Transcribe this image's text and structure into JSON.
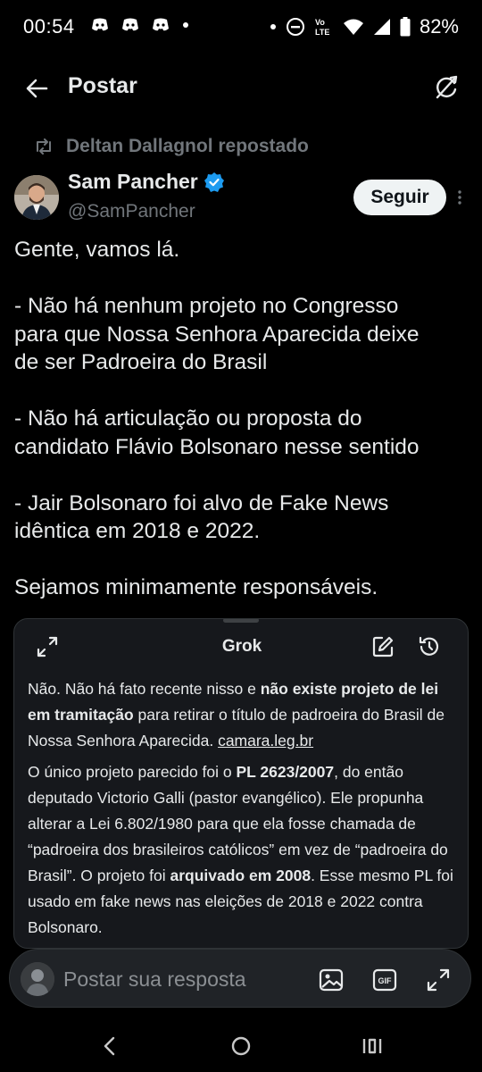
{
  "status_bar": {
    "time": "00:54",
    "battery": "82%",
    "left_icons": [
      "discord-icon",
      "discord-icon",
      "discord-icon",
      "dot-icon"
    ],
    "right_icons": [
      "dot-icon",
      "dnd-icon",
      "volte-icon",
      "wifi-icon",
      "signal-icon",
      "battery-icon"
    ]
  },
  "header": {
    "title": "Postar"
  },
  "repost": {
    "text": "Deltan Dallagnol repostado"
  },
  "author": {
    "name": "Sam Pancher",
    "handle": "@SamPancher",
    "verified": true,
    "follow_label": "Seguir"
  },
  "post": {
    "lines": [
      "Gente, vamos lá.",
      "",
      "- Não há nenhum projeto no Congresso",
      "para que Nossa Senhora Aparecida deixe",
      "de ser Padroeira do Brasil",
      "",
      "- Não há articulação ou proposta do",
      "candidato Flávio Bolsonaro nesse sentido",
      "",
      "- Jair Bolsonaro foi alvo de Fake News",
      "idêntica em 2018 e 2022.",
      "",
      "Sejamos minimamente responsáveis."
    ]
  },
  "grok": {
    "title": "Grok",
    "p1": {
      "t1": "Não. Não há fato recente nisso e ",
      "b1": "não existe projeto de lei em tramitação",
      "t2": " para retirar o título de padroeira do Brasil de Nossa Senhora Aparecida. ",
      "link": "camara.leg.br"
    },
    "p2": {
      "t1": "O único projeto parecido foi o ",
      "b1": "PL 2623/2007",
      "t2": ", do então deputado Victorio Galli (pastor evangélico). Ele propunha alterar a Lei 6.802/1980 para que ela fosse chamada de “padroeira dos brasileiros católicos” em vez de “padroeira do Brasil”. O projeto foi ",
      "b2": "arquivado em 2008",
      "t3": ". Esse mesmo PL foi usado em fake news nas eleições de 2018 e 2022 contra Bolsonaro."
    }
  },
  "reply": {
    "placeholder": "Postar sua resposta"
  },
  "colors": {
    "background": "#000000",
    "text": "#e7e9ea",
    "muted": "#71767b",
    "verified": "#1d9bf0",
    "card": "#16181c"
  }
}
